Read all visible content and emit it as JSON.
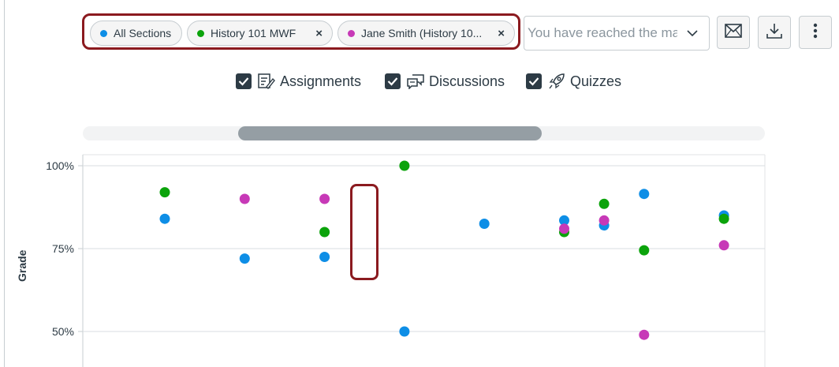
{
  "filters": {
    "pills": [
      {
        "label": "All Sections",
        "color": "#0e8ee6",
        "removable": false
      },
      {
        "label": "History 101 MWF",
        "color": "#0ba30b",
        "removable": true
      },
      {
        "label": "Jane Smith (History 10...",
        "color": "#c739b7",
        "removable": true
      }
    ],
    "limit_placeholder": "You have reached the ma",
    "remove_symbol": "×"
  },
  "toolbar": {
    "mail_icon": "envelope-icon",
    "download_icon": "download-icon",
    "more_icon": "kebab-menu-icon"
  },
  "types": {
    "assignments": {
      "label": "Assignments",
      "checked": true
    },
    "discussions": {
      "label": "Discussions",
      "checked": true
    },
    "quizzes": {
      "label": "Quizzes",
      "checked": true
    }
  },
  "scroll_position": 0.23,
  "chart_data": {
    "type": "scatter",
    "ylabel": "Grade",
    "yticks": [
      "100%",
      "75%",
      "50%"
    ],
    "ylim": [
      45,
      103
    ],
    "grid": true,
    "series": [
      {
        "color": "#0e8ee6",
        "points": [
          [
            1,
            84
          ],
          [
            2,
            72
          ],
          [
            3,
            72.5
          ],
          [
            4,
            50
          ],
          [
            5,
            82.5
          ],
          [
            6,
            83.5
          ],
          [
            6.5,
            82
          ],
          [
            7,
            91.5
          ],
          [
            8,
            85
          ]
        ]
      },
      {
        "color": "#0ba30b",
        "points": [
          [
            1,
            92
          ],
          [
            3,
            80
          ],
          [
            4,
            100
          ],
          [
            6,
            80
          ],
          [
            6.5,
            88.5
          ],
          [
            7,
            74.5
          ],
          [
            8,
            84
          ]
        ]
      },
      {
        "color": "#c739b7",
        "points": [
          [
            2,
            90
          ],
          [
            3,
            90
          ],
          [
            6,
            81
          ],
          [
            6.5,
            83.5
          ],
          [
            7,
            49
          ],
          [
            8,
            76
          ]
        ]
      }
    ]
  }
}
